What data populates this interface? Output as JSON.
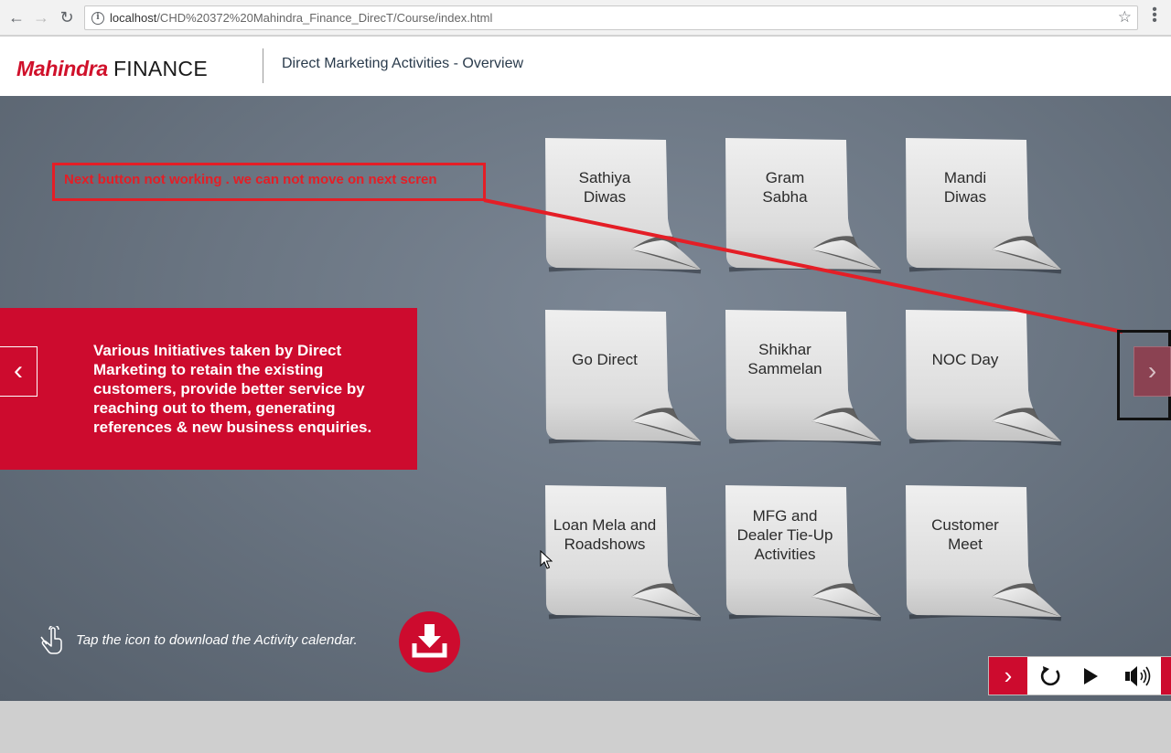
{
  "browser": {
    "url_host": "localhost",
    "url_path": "/CHD%20372%20Mahindra_Finance_DirecT/Course/index.html"
  },
  "header": {
    "logo_mahindra": "Mahindra",
    "logo_finance": "FINANCE",
    "title": "Direct Marketing Activities - Overview"
  },
  "annotation": {
    "text": "Next button not working . we can not move on next scren"
  },
  "info_panel": {
    "text": "Various Initiatives taken by Direct Marketing to retain the existing customers, provide better service by reaching out to them, generating references & new business enquiries."
  },
  "notes": [
    {
      "label": "Sathiya\nDiwas"
    },
    {
      "label": "Gram\nSabha"
    },
    {
      "label": "Mandi\nDiwas"
    },
    {
      "label": "Go Direct"
    },
    {
      "label": "Shikhar\nSammelan"
    },
    {
      "label": "NOC Day"
    },
    {
      "label": "Loan Mela and\nRoadshows"
    },
    {
      "label": "MFG and\nDealer Tie-Up\nActivities"
    },
    {
      "label": "Customer\nMeet"
    }
  ],
  "download": {
    "hint": "Tap the icon to download the Activity calendar."
  },
  "icons": {
    "back": "back-arrow-icon",
    "forward": "forward-arrow-icon",
    "reload": "reload-icon",
    "info": "info-icon",
    "star": "bookmark-star-icon",
    "menu": "kebab-menu-icon",
    "prev": "chevron-left-icon",
    "next": "chevron-right-icon",
    "hand": "tap-hand-icon",
    "download": "download-icon",
    "replay": "replay-icon",
    "play": "play-icon",
    "audio": "speaker-icon"
  },
  "colors": {
    "brand_red": "#cd0b2e",
    "annotation_red": "#e41e26",
    "stage_bg": "#6b7683"
  }
}
